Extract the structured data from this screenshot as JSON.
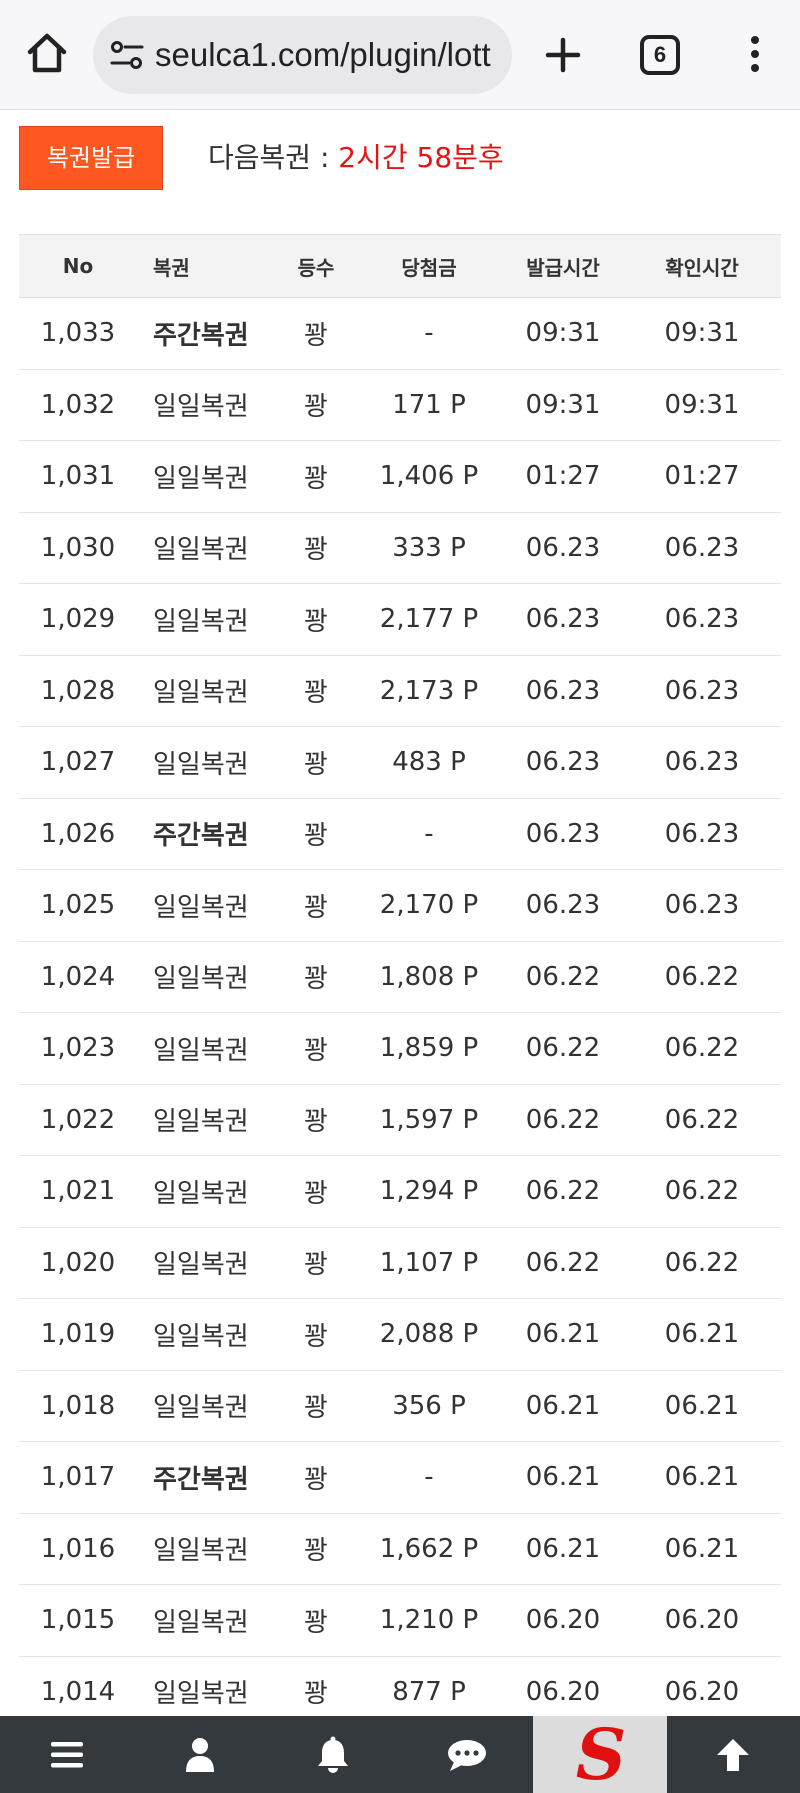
{
  "browser": {
    "url": "seulca1.com/plugin/lott",
    "tab_count": "6"
  },
  "header": {
    "issue_button": "복권발급",
    "next_label": "다음복권 : ",
    "next_time": "2시간 58분후"
  },
  "table": {
    "columns": [
      "No",
      "복권",
      "등수",
      "당첨금",
      "발급시간",
      "확인시간"
    ],
    "rows": [
      {
        "no": "1,033",
        "type": "주간복권",
        "weekly": true,
        "rank": "꽝",
        "prize": "-",
        "issued": "09:31",
        "checked": "09:31"
      },
      {
        "no": "1,032",
        "type": "일일복권",
        "weekly": false,
        "rank": "꽝",
        "prize": "171 P",
        "issued": "09:31",
        "checked": "09:31"
      },
      {
        "no": "1,031",
        "type": "일일복권",
        "weekly": false,
        "rank": "꽝",
        "prize": "1,406 P",
        "issued": "01:27",
        "checked": "01:27"
      },
      {
        "no": "1,030",
        "type": "일일복권",
        "weekly": false,
        "rank": "꽝",
        "prize": "333 P",
        "issued": "06.23",
        "checked": "06.23"
      },
      {
        "no": "1,029",
        "type": "일일복권",
        "weekly": false,
        "rank": "꽝",
        "prize": "2,177 P",
        "issued": "06.23",
        "checked": "06.23"
      },
      {
        "no": "1,028",
        "type": "일일복권",
        "weekly": false,
        "rank": "꽝",
        "prize": "2,173 P",
        "issued": "06.23",
        "checked": "06.23"
      },
      {
        "no": "1,027",
        "type": "일일복권",
        "weekly": false,
        "rank": "꽝",
        "prize": "483 P",
        "issued": "06.23",
        "checked": "06.23"
      },
      {
        "no": "1,026",
        "type": "주간복권",
        "weekly": true,
        "rank": "꽝",
        "prize": "-",
        "issued": "06.23",
        "checked": "06.23"
      },
      {
        "no": "1,025",
        "type": "일일복권",
        "weekly": false,
        "rank": "꽝",
        "prize": "2,170 P",
        "issued": "06.23",
        "checked": "06.23"
      },
      {
        "no": "1,024",
        "type": "일일복권",
        "weekly": false,
        "rank": "꽝",
        "prize": "1,808 P",
        "issued": "06.22",
        "checked": "06.22"
      },
      {
        "no": "1,023",
        "type": "일일복권",
        "weekly": false,
        "rank": "꽝",
        "prize": "1,859 P",
        "issued": "06.22",
        "checked": "06.22"
      },
      {
        "no": "1,022",
        "type": "일일복권",
        "weekly": false,
        "rank": "꽝",
        "prize": "1,597 P",
        "issued": "06.22",
        "checked": "06.22"
      },
      {
        "no": "1,021",
        "type": "일일복권",
        "weekly": false,
        "rank": "꽝",
        "prize": "1,294 P",
        "issued": "06.22",
        "checked": "06.22"
      },
      {
        "no": "1,020",
        "type": "일일복권",
        "weekly": false,
        "rank": "꽝",
        "prize": "1,107 P",
        "issued": "06.22",
        "checked": "06.22"
      },
      {
        "no": "1,019",
        "type": "일일복권",
        "weekly": false,
        "rank": "꽝",
        "prize": "2,088 P",
        "issued": "06.21",
        "checked": "06.21"
      },
      {
        "no": "1,018",
        "type": "일일복권",
        "weekly": false,
        "rank": "꽝",
        "prize": "356 P",
        "issued": "06.21",
        "checked": "06.21"
      },
      {
        "no": "1,017",
        "type": "주간복권",
        "weekly": true,
        "rank": "꽝",
        "prize": "-",
        "issued": "06.21",
        "checked": "06.21"
      },
      {
        "no": "1,016",
        "type": "일일복권",
        "weekly": false,
        "rank": "꽝",
        "prize": "1,662 P",
        "issued": "06.21",
        "checked": "06.21"
      },
      {
        "no": "1,015",
        "type": "일일복권",
        "weekly": false,
        "rank": "꽝",
        "prize": "1,210 P",
        "issued": "06.20",
        "checked": "06.20"
      },
      {
        "no": "1,014",
        "type": "일일복권",
        "weekly": false,
        "rank": "꽝",
        "prize": "877 P",
        "issued": "06.20",
        "checked": "06.20"
      }
    ]
  },
  "bottom_nav": {
    "items": [
      {
        "icon": "hamburger-menu-icon"
      },
      {
        "icon": "user-icon"
      },
      {
        "icon": "bell-icon"
      },
      {
        "icon": "chat-bubble-icon"
      },
      {
        "icon": "site-logo",
        "logo_letter": "S"
      },
      {
        "icon": "arrow-up-icon"
      }
    ]
  },
  "colors": {
    "accent": "#ff5722",
    "countdown": "#e31414",
    "nav_bg": "#34393e",
    "logo": "#e01010"
  }
}
